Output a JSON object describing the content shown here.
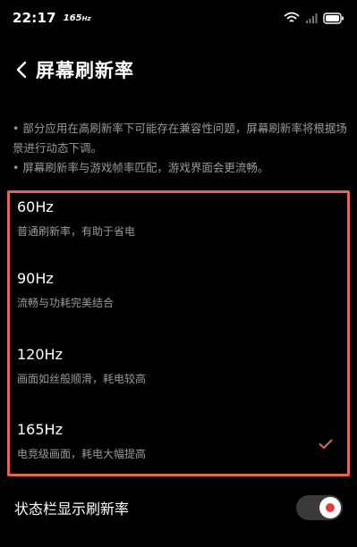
{
  "status_bar": {
    "time": "22:17",
    "refresh_rate": "165",
    "refresh_unit": "Hz"
  },
  "header": {
    "title": "屏幕刷新率"
  },
  "notes": [
    "• 部分应用在高刷新率下可能存在兼容性问题，屏幕刷新率将根据场景进行动态下调。",
    "• 屏幕刷新率与游戏帧率匹配，游戏界面会更流畅。"
  ],
  "options": [
    {
      "title": "60Hz",
      "description": "普通刷新率，有助于省电",
      "selected": false
    },
    {
      "title": "90Hz",
      "description": "流畅与功耗完美结合",
      "selected": false
    },
    {
      "title": "120Hz",
      "description": "画面如丝般顺滑，耗电较高",
      "selected": false
    },
    {
      "title": "165Hz",
      "description": "电竞级画面，耗电大幅提高",
      "selected": true
    }
  ],
  "status_bar_setting": {
    "label": "状态栏显示刷新率",
    "enabled": true
  },
  "colors": {
    "accent": "#e2664e",
    "toggle_dot": "#e23d3d",
    "secondary_text": "#9a9a9a"
  },
  "icons": {
    "back": "chevron-left-icon",
    "check": "check-icon",
    "wifi": "wifi-icon",
    "signal": "signal-icon",
    "battery": "battery-icon"
  }
}
